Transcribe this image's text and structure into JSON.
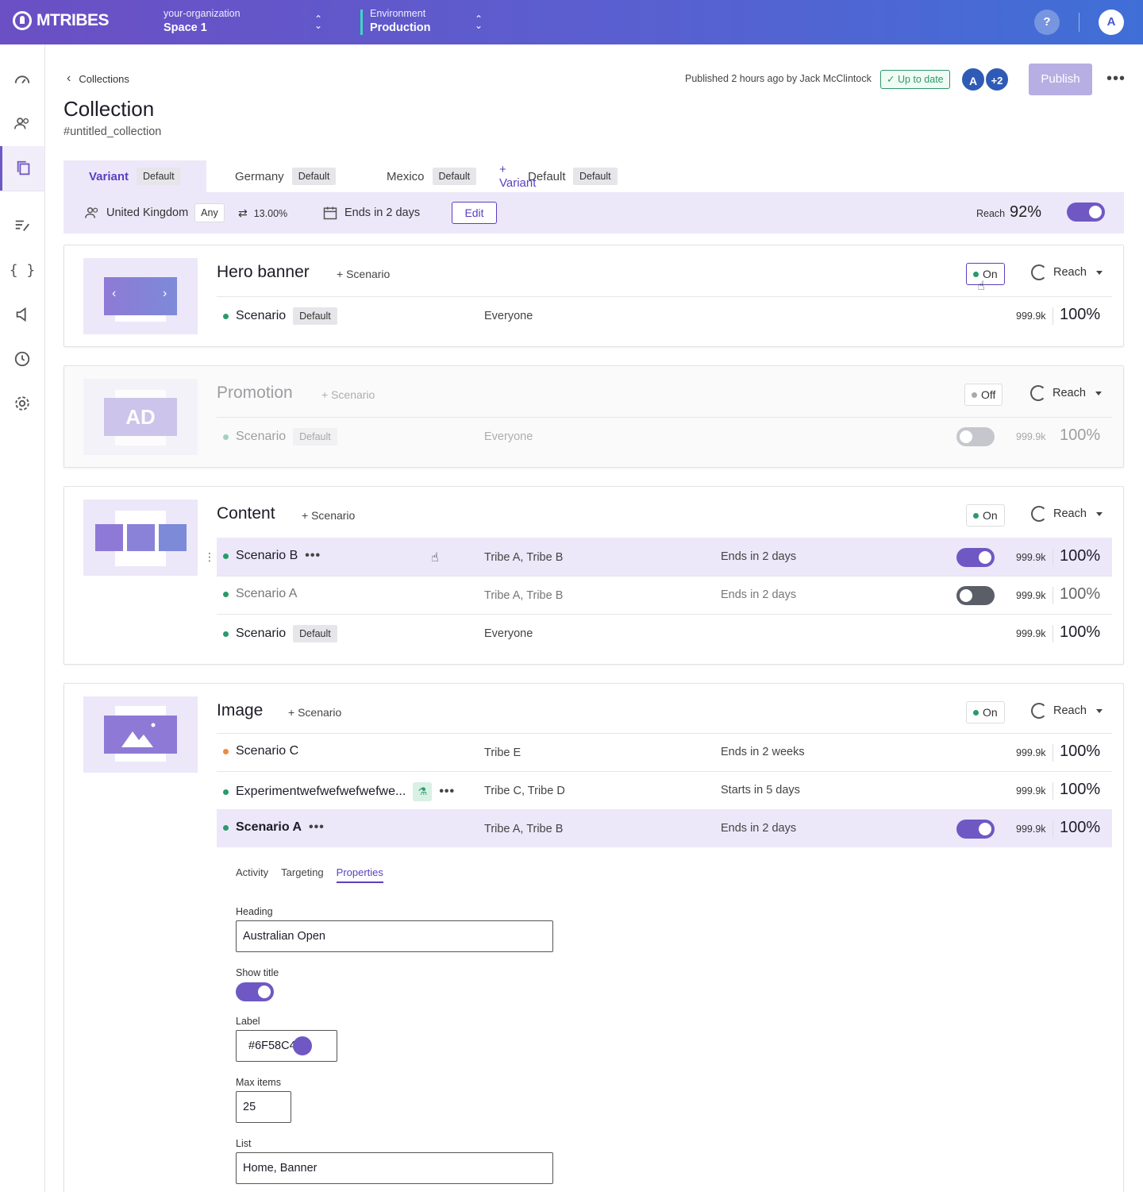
{
  "topbar": {
    "brand": "MTRIBES",
    "org_label": "your-organization",
    "space": "Space 1",
    "env_label": "Environment",
    "env": "Production",
    "help": "?",
    "user_initial": "A"
  },
  "header": {
    "breadcrumb": "Collections",
    "title": "Collection",
    "subtitle": "#untitled_collection",
    "published": "Published 2 hours ago by Jack McClintock",
    "status": "Up to date",
    "avatar_initial": "A",
    "avatar_more": "+2",
    "publish": "Publish"
  },
  "tabs": [
    {
      "label": "Variant",
      "badge": "Default"
    },
    {
      "label": "Germany",
      "badge": "Default"
    },
    {
      "label": "Mexico",
      "badge": "Default"
    },
    {
      "label": "+ Variant",
      "overlay": "Default",
      "badge": "Default"
    }
  ],
  "variant_bar": {
    "audience": "United Kingdom",
    "any": "Any",
    "split": "13.00%",
    "ends": "Ends in 2 days",
    "edit": "Edit",
    "reach_label": "Reach",
    "reach_value": "92%"
  },
  "common": {
    "add_scenario": "+ Scenario",
    "reach": "Reach",
    "default": "Default"
  },
  "cards": {
    "hero": {
      "title": "Hero banner",
      "status": "On",
      "rows": [
        {
          "name": "Scenario",
          "tribes": "Everyone",
          "count": "999.9k",
          "pct": "100%"
        }
      ]
    },
    "promo": {
      "title": "Promotion",
      "status": "Off",
      "thumb_text": "AD",
      "rows": [
        {
          "name": "Scenario",
          "tribes": "Everyone",
          "count": "999.9k",
          "pct": "100%"
        }
      ]
    },
    "content": {
      "title": "Content",
      "status": "On",
      "rows": [
        {
          "name": "Scenario B",
          "tribes": "Tribe A, Tribe B",
          "ends": "Ends in 2 days",
          "count": "999.9k",
          "pct": "100%"
        },
        {
          "name": "Scenario A",
          "tribes": "Tribe A, Tribe B",
          "ends": "Ends in 2 days",
          "count": "999.9k",
          "pct": "100%"
        },
        {
          "name": "Scenario",
          "tribes": "Everyone",
          "count": "999.9k",
          "pct": "100%"
        }
      ]
    },
    "image": {
      "title": "Image",
      "status": "On",
      "rows": [
        {
          "name": "Scenario C",
          "tribes": "Tribe E",
          "ends": "Ends in 2 weeks",
          "count": "999.9k",
          "pct": "100%"
        },
        {
          "name": "Experimentwefwefwefwefwe...",
          "tribes": "Tribe C, Tribe D",
          "ends": "Starts in 5 days",
          "count": "999.9k",
          "pct": "100%"
        },
        {
          "name": "Scenario A",
          "tribes": "Tribe A, Tribe B",
          "ends": "Ends in 2 days",
          "count": "999.9k",
          "pct": "100%"
        }
      ]
    }
  },
  "properties": {
    "tabs": [
      "Activity",
      "Targeting",
      "Properties"
    ],
    "heading_label": "Heading",
    "heading_value": "Australian Open",
    "show_title_label": "Show title",
    "label_label": "Label",
    "label_value": "#6F58C4",
    "max_items_label": "Max items",
    "max_items_value": "25",
    "list_label": "List",
    "list_value": "Home, Banner"
  },
  "colors": {
    "accent": "#6f58c4",
    "on_dot": "#2a9a6a",
    "warn_dot": "#f08a3c"
  }
}
